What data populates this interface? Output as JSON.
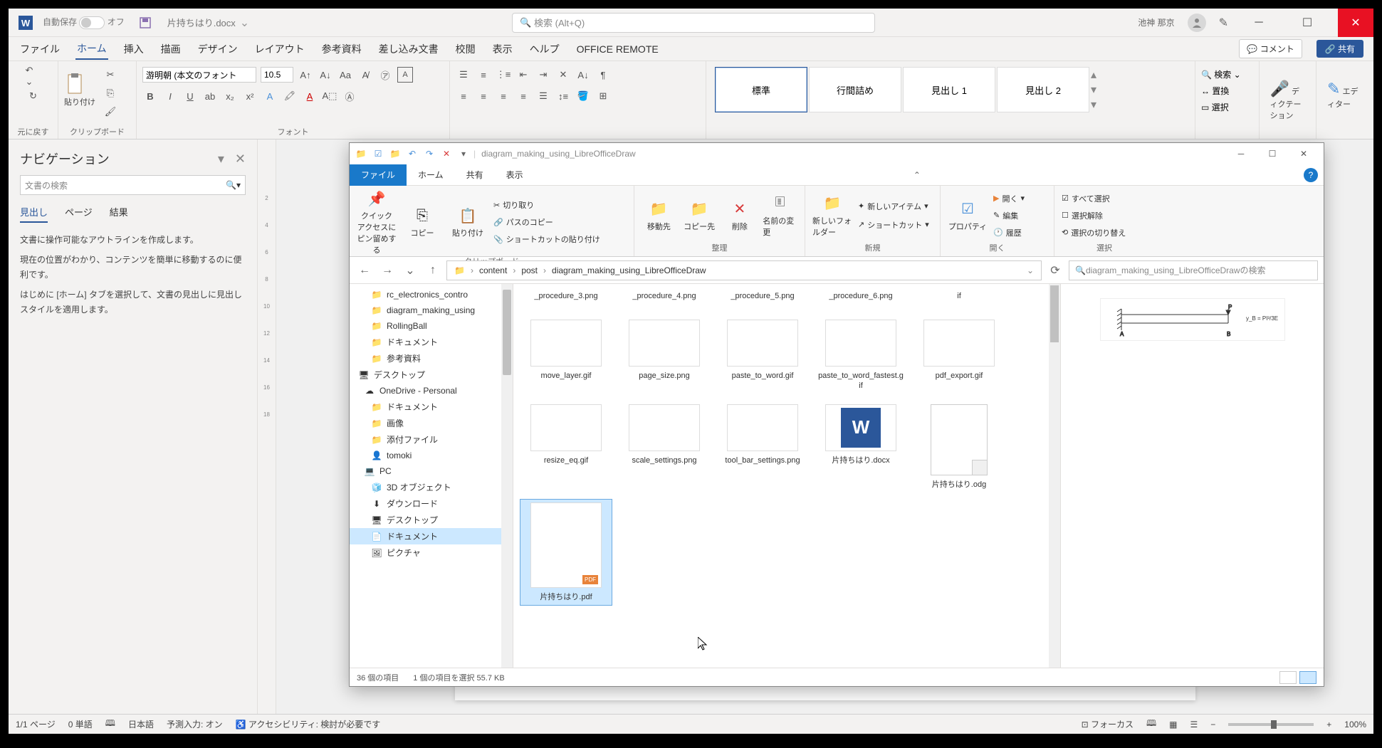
{
  "word": {
    "autosave_label": "自動保存",
    "autosave_state": "オフ",
    "doc_name": "片持ちはり.docx",
    "search_placeholder": "検索 (Alt+Q)",
    "user_name": "池神 那京",
    "tabs": [
      "ファイル",
      "ホーム",
      "挿入",
      "描画",
      "デザイン",
      "レイアウト",
      "参考資料",
      "差し込み文書",
      "校閲",
      "表示",
      "ヘルプ",
      "OFFICE REMOTE"
    ],
    "comment_btn": "コメント",
    "share_btn": "共有",
    "ribbon_groups": {
      "undo": "元に戻す",
      "clipboard": "クリップボード",
      "font": "フォント",
      "editing_search": "検索",
      "editing_replace": "置換",
      "editing_select": "選択",
      "dictation": "ディクテーション",
      "editor": "エディター"
    },
    "paste_label": "貼り付け",
    "font_name": "游明朝 (本文のフォント",
    "font_size": "10.5",
    "styles": [
      "標準",
      "行間詰め",
      "見出し 1",
      "見出し 2"
    ],
    "nav": {
      "title": "ナビゲーション",
      "search_placeholder": "文書の検索",
      "tabs": [
        "見出し",
        "ページ",
        "結果"
      ],
      "body1": "文書に操作可能なアウトラインを作成します。",
      "body2": "現在の位置がわかり、コンテンツを簡単に移動するのに便利です。",
      "body3": "はじめに [ホーム] タブを選択して、文書の見出しに見出しスタイルを適用します。"
    },
    "status": {
      "page": "1/1 ページ",
      "words": "0 単語",
      "lang": "日本語",
      "predict": "予測入力: オン",
      "a11y": "アクセシビリティ: 検討が必要です",
      "focus": "フォーカス",
      "zoom": "100%"
    }
  },
  "explorer": {
    "title": "diagram_making_using_LibreOfficeDraw",
    "tabs": [
      "ファイル",
      "ホーム",
      "共有",
      "表示"
    ],
    "ribbon": {
      "pin": "クイック アクセスにピン留めする",
      "copy": "コピー",
      "paste": "貼り付け",
      "cut": "切り取り",
      "copy_path": "パスのコピー",
      "paste_shortcut": "ショートカットの貼り付け",
      "clipboard": "クリップボード",
      "move_to": "移動先",
      "copy_to": "コピー先",
      "delete": "削除",
      "rename": "名前の変更",
      "organize": "整理",
      "new_folder": "新しいフォルダー",
      "new_item": "新しいアイテム",
      "shortcut": "ショートカット",
      "new": "新規",
      "properties": "プロパティ",
      "open": "開く",
      "edit": "編集",
      "history": "履歴",
      "open_group": "開く",
      "select_all": "すべて選択",
      "select_none": "選択解除",
      "select_invert": "選択の切り替え",
      "select": "選択"
    },
    "breadcrumbs": [
      "content",
      "post",
      "diagram_making_using_LibreOfficeDraw"
    ],
    "search_placeholder": "diagram_making_using_LibreOfficeDrawの検索",
    "tree": [
      {
        "label": "rc_electronics_contro",
        "icon": "folder"
      },
      {
        "label": "diagram_making_using",
        "icon": "folder"
      },
      {
        "label": "RollingBall",
        "icon": "folder"
      },
      {
        "label": "ドキュメント",
        "icon": "folder"
      },
      {
        "label": "参考資料",
        "icon": "folder"
      },
      {
        "label": "デスクトップ",
        "icon": "desktop"
      },
      {
        "label": "OneDrive - Personal",
        "icon": "onedrive"
      },
      {
        "label": "ドキュメント",
        "icon": "folder"
      },
      {
        "label": "画像",
        "icon": "folder"
      },
      {
        "label": "添付ファイル",
        "icon": "folder"
      },
      {
        "label": "tomoki",
        "icon": "user"
      },
      {
        "label": "PC",
        "icon": "pc"
      },
      {
        "label": "3D オブジェクト",
        "icon": "3d"
      },
      {
        "label": "ダウンロード",
        "icon": "download"
      },
      {
        "label": "デスクトップ",
        "icon": "desktop2"
      },
      {
        "label": "ドキュメント",
        "icon": "doc",
        "selected": true
      },
      {
        "label": "ピクチャ",
        "icon": "pic"
      }
    ],
    "files_top": [
      {
        "name": "_procedure_3.png"
      },
      {
        "name": "_procedure_4.png"
      },
      {
        "name": "_procedure_5.png"
      },
      {
        "name": "_procedure_6.png"
      },
      {
        "name": "if"
      }
    ],
    "files": [
      {
        "name": "move_layer.gif",
        "thumb": "img"
      },
      {
        "name": "page_size.png",
        "thumb": "img"
      },
      {
        "name": "paste_to_word.gif",
        "thumb": "img"
      },
      {
        "name": "paste_to_word_fastest.gif",
        "thumb": "img"
      },
      {
        "name": "pdf_export.gif",
        "thumb": "img"
      },
      {
        "name": "resize_eq.gif",
        "thumb": "img"
      },
      {
        "name": "scale_settings.png",
        "thumb": "img"
      },
      {
        "name": "tool_bar_settings.png",
        "thumb": "img"
      },
      {
        "name": "片持ちはり.docx",
        "thumb": "doc"
      },
      {
        "name": "片持ちはり.odg",
        "thumb": "odg"
      },
      {
        "name": "片持ちはり.pdf",
        "thumb": "pdf",
        "selected": true
      }
    ],
    "status": {
      "count": "36 個の項目",
      "selected": "1 個の項目を選択 55.7 KB"
    }
  }
}
